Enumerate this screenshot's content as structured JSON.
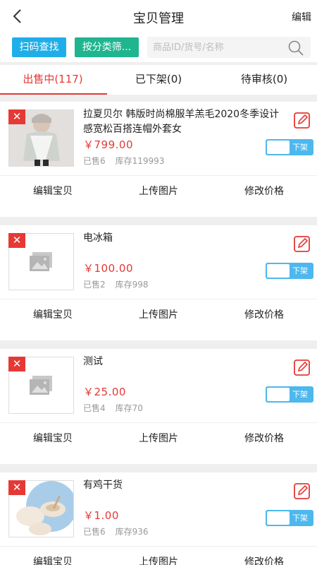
{
  "header": {
    "title": "宝贝管理",
    "edit_label": "编辑"
  },
  "toolbar": {
    "scan_label": "扫码查找",
    "category_label": "按分类筛...",
    "search_placeholder": "商品ID/货号/名称"
  },
  "tabs": [
    {
      "label": "出售中(117)",
      "active": true
    },
    {
      "label": "已下架(0)",
      "active": false
    },
    {
      "label": "待审核(0)",
      "active": false
    }
  ],
  "products": [
    {
      "title": "拉夏贝尔  韩版时尚棉服羊羔毛2020冬季设计感宽松百搭连帽外套女",
      "price": "￥799.00",
      "sold": "已售6",
      "stock": "库存119993",
      "image": "coat-photo",
      "toggle_label": "下架"
    },
    {
      "title": "电冰箱",
      "price": "￥100.00",
      "sold": "已售2",
      "stock": "库存998",
      "image": "placeholder-image",
      "toggle_label": "下架"
    },
    {
      "title": "测试",
      "price": "￥25.00",
      "sold": "已售4",
      "stock": "库存70",
      "image": "placeholder-image",
      "toggle_label": "下架"
    },
    {
      "title": "有鸡干货",
      "price": "￥1.00",
      "sold": "已售6",
      "stock": "库存936",
      "image": "bowls-photo",
      "toggle_label": "下架"
    }
  ],
  "card_actions": {
    "edit": "编辑宝贝",
    "upload": "上传图片",
    "price": "修改价格"
  },
  "colors": {
    "accent_red": "#e53935",
    "scan_blue": "#1faee8",
    "category_green": "#1fb58f",
    "toggle_blue": "#4db8ee"
  }
}
